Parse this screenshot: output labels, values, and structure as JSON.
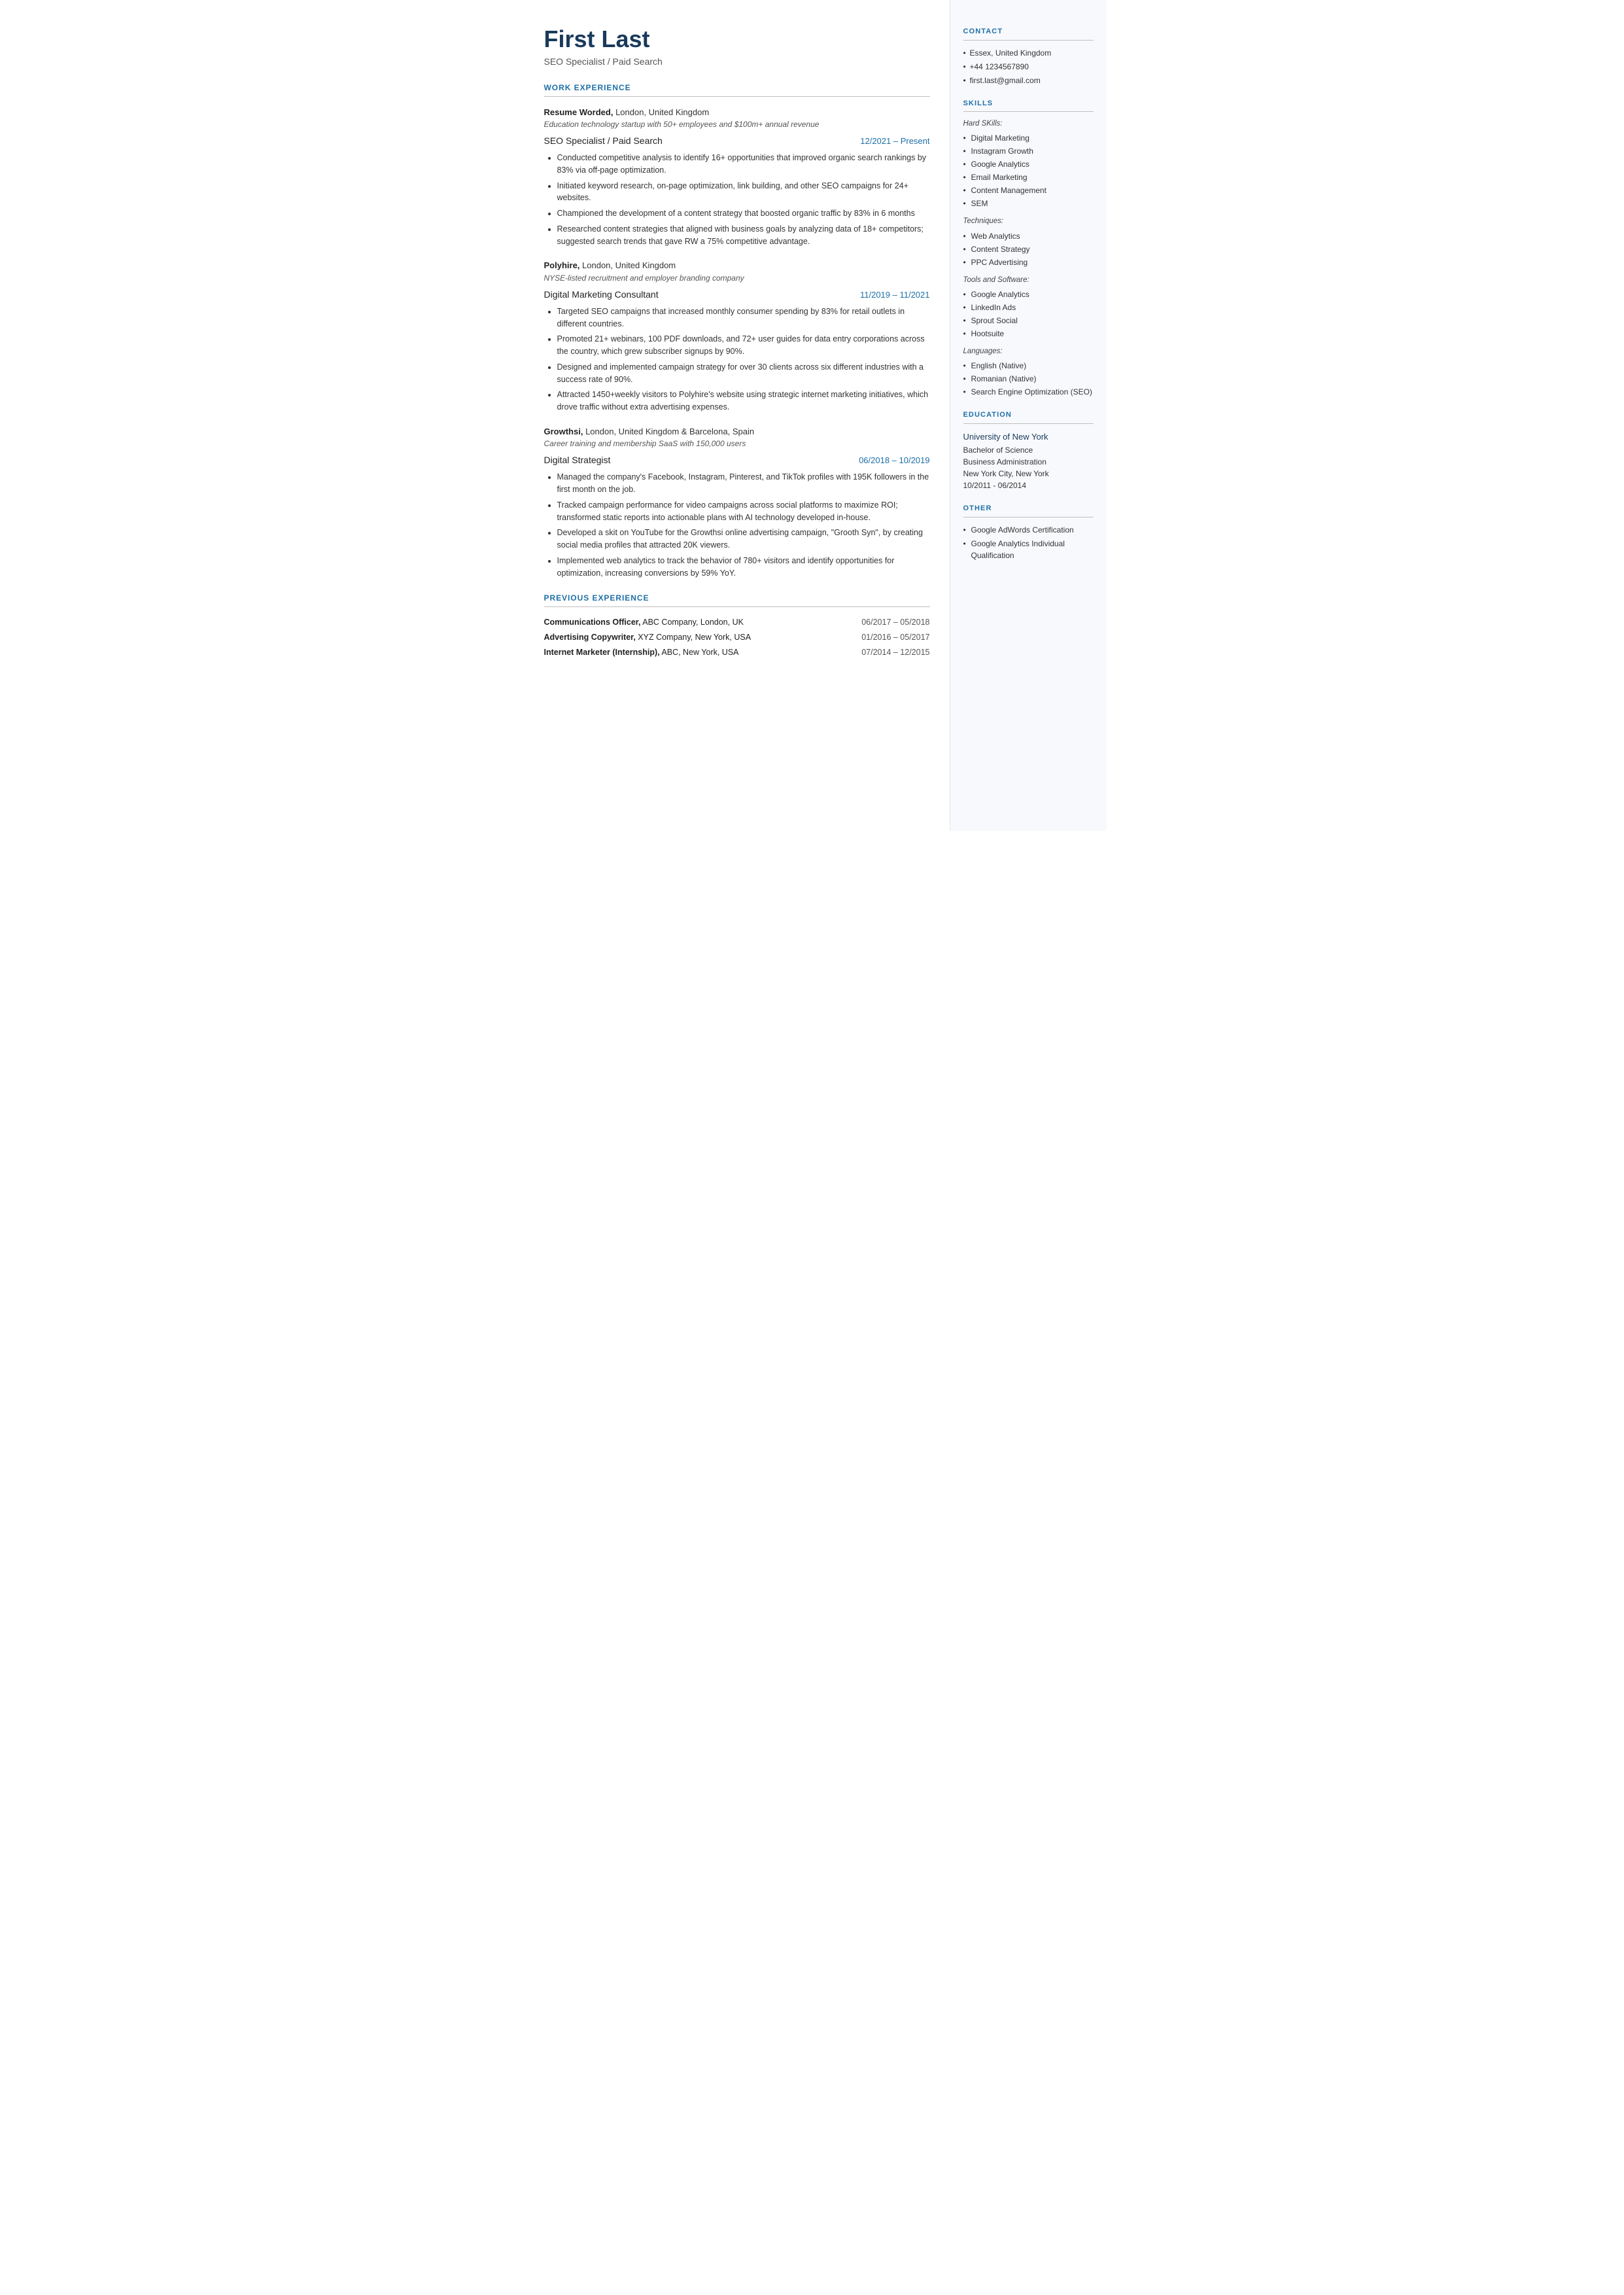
{
  "header": {
    "name": "First Last",
    "subtitle": "SEO Specialist / Paid Search"
  },
  "sections": {
    "work_experience_title": "WORK EXPERIENCE",
    "previous_experience_title": "PREVIOUS EXPERIENCE"
  },
  "jobs": [
    {
      "employer": "Resume Worded,",
      "employer_suffix": " London, United Kingdom",
      "desc": "Education technology startup with 50+ employees and $100m+ annual revenue",
      "title": "SEO Specialist / Paid Search",
      "dates": "12/2021 – Present",
      "bullets": [
        "Conducted competitive analysis to identify 16+ opportunities that improved organic search rankings by 83% via off-page optimization.",
        "Initiated keyword research, on-page optimization, link building, and other SEO campaigns for 24+ websites.",
        "Championed the development of a content strategy that boosted organic traffic by 83% in 6 months",
        "Researched content strategies that aligned with business goals by analyzing data of 18+ competitors; suggested search trends that gave RW a 75% competitive advantage."
      ]
    },
    {
      "employer": "Polyhire,",
      "employer_suffix": " London, United Kingdom",
      "desc": "NYSE-listed recruitment and employer branding company",
      "title": "Digital Marketing Consultant",
      "dates": "11/2019 – 11/2021",
      "bullets": [
        "Targeted SEO campaigns that increased monthly consumer spending by 83% for retail outlets in different countries.",
        "Promoted 21+ webinars, 100 PDF downloads, and 72+ user guides for data entry corporations across the country, which grew subscriber signups by 90%.",
        "Designed and implemented campaign strategy for over 30 clients across six different industries with a success rate of 90%.",
        "Attracted 1450+weekly visitors to Polyhire's website using strategic internet marketing initiatives, which drove traffic without extra advertising expenses."
      ]
    },
    {
      "employer": "Growthsi,",
      "employer_suffix": " London, United Kingdom & Barcelona, Spain",
      "desc": "Career training and membership SaaS with 150,000 users",
      "title": "Digital Strategist",
      "dates": "06/2018 – 10/2019",
      "bullets": [
        "Managed the company's Facebook, Instagram, Pinterest, and TikTok profiles with 195K followers in the first month on the job.",
        "Tracked campaign performance for video campaigns across social platforms to maximize ROI; transformed static reports into actionable plans with AI technology developed in-house.",
        "Developed a skit on YouTube for the Growthsi online advertising campaign, \"Grooth Syn\", by creating social media profiles that attracted 20K viewers.",
        "Implemented web analytics to track the behavior of 780+ visitors and identify opportunities for optimization, increasing conversions by 59% YoY."
      ]
    }
  ],
  "previous_experience": [
    {
      "bold_part": "Communications Officer,",
      "rest": " ABC Company, London, UK",
      "dates": "06/2017 – 05/2018"
    },
    {
      "bold_part": "Advertising Copywriter,",
      "rest": " XYZ Company, New York, USA",
      "dates": "01/2016 – 05/2017"
    },
    {
      "bold_part": "Internet Marketer (Internship),",
      "rest": " ABC, New York, USA",
      "dates": "07/2014 – 12/2015"
    }
  ],
  "contact": {
    "title": "CONTACT",
    "items": [
      "Essex, United Kingdom",
      "+44 1234567890",
      "first.last@gmail.com"
    ]
  },
  "skills": {
    "title": "SKILLS",
    "hard_label": "Hard SKills:",
    "hard": [
      "Digital Marketing",
      "Instagram Growth",
      "Google Analytics",
      "Email Marketing",
      "Content Management",
      "SEM"
    ],
    "techniques_label": "Techniques:",
    "techniques": [
      "Web Analytics",
      "Content Strategy",
      "PPC Advertising"
    ],
    "tools_label": "Tools and Software:",
    "tools": [
      "Google Analytics",
      "LinkedIn Ads",
      "Sprout Social",
      "Hootsuite"
    ],
    "languages_label": "Languages:",
    "languages": [
      "English (Native)",
      "Romanian (Native)",
      "Search Engine Optimization (SEO)"
    ]
  },
  "education": {
    "title": "EDUCATION",
    "school": "University of New York",
    "degree": "Bachelor of Science",
    "field": "Business Administration",
    "location": "New York City, New York",
    "dates": "10/2011 - 06/2014"
  },
  "other": {
    "title": "OTHER",
    "items": [
      "Google AdWords Certification",
      "Google Analytics Individual Qualification"
    ]
  }
}
